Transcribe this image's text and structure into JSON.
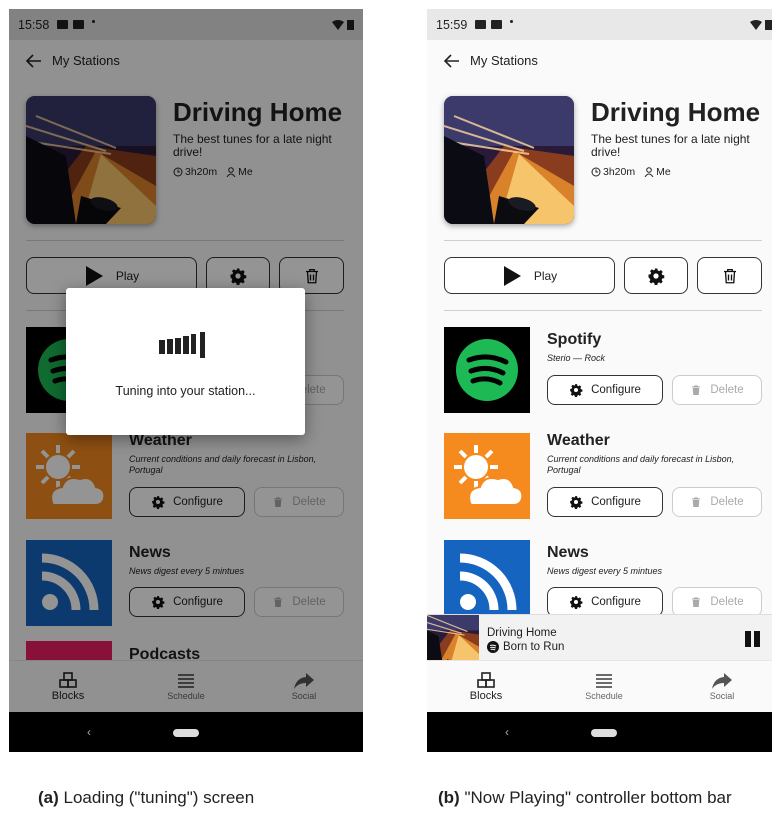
{
  "panel_a": {
    "status_time": "15:58",
    "loading_text": "Tuning into your station...",
    "caption_label": "(a)",
    "caption_text": "Loading (\"tuning\") screen"
  },
  "panel_b": {
    "status_time": "15:59",
    "caption_label": "(b)",
    "caption_text": "\"Now Playing\" controller bottom bar",
    "now_playing": {
      "station": "Driving Home",
      "track": "Born to Run"
    }
  },
  "appbar": {
    "back_label": "My Stations"
  },
  "station": {
    "title": "Driving Home",
    "description": "The best tunes for a late night drive!",
    "duration": "3h20m",
    "owner": "Me"
  },
  "actions": {
    "play_label": "Play"
  },
  "blocks": [
    {
      "name": "Spotify",
      "subtitle": "Sterio — Rock",
      "configure_label": "Configure",
      "delete_label": "Delete",
      "color": "#000000"
    },
    {
      "name": "Weather",
      "subtitle": "Current conditions and daily forecast in Lisbon, Portugal",
      "configure_label": "Configure",
      "delete_label": "Delete",
      "color": "#f58a1f"
    },
    {
      "name": "News",
      "subtitle": "News digest every 5 mintues",
      "configure_label": "Configure",
      "delete_label": "Delete",
      "color": "#1565c0"
    },
    {
      "name": "Podcasts",
      "color": "#e91e63"
    }
  ],
  "bottom_nav": [
    {
      "label": "Blocks",
      "icon": "blocks-icon",
      "active": true
    },
    {
      "label": "Schedule",
      "icon": "menu-icon",
      "active": false
    },
    {
      "label": "Social",
      "icon": "share-icon",
      "active": false
    }
  ]
}
